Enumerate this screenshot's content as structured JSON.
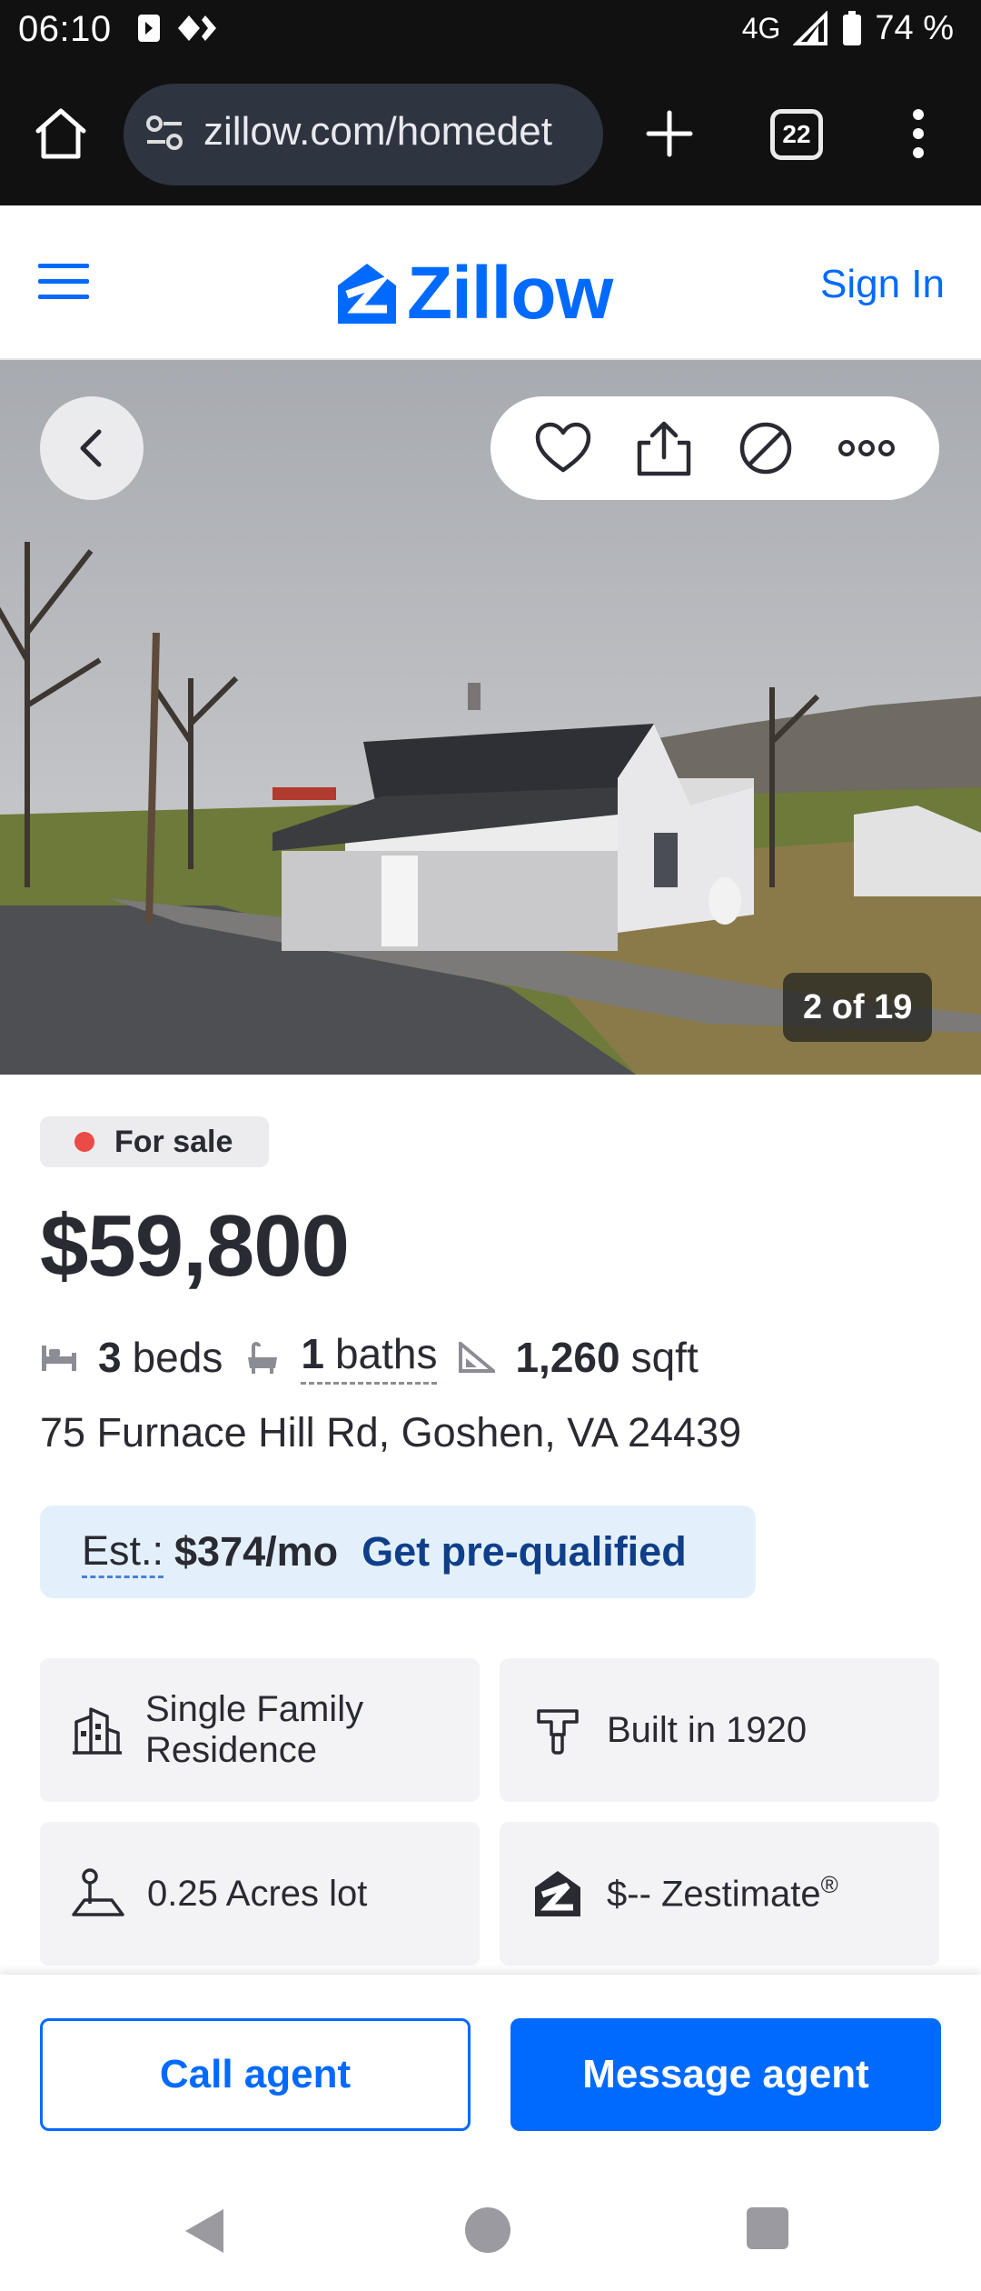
{
  "status_bar": {
    "time": "06:10",
    "network": "4G",
    "battery": "74 %"
  },
  "browser": {
    "url": "zillow.com/homedet",
    "tab_count": "22"
  },
  "header": {
    "logo_text": "Zillow",
    "sign_in_label": "Sign In",
    "brand_color": "#006aff"
  },
  "gallery": {
    "photo_counter": "2 of 19"
  },
  "listing": {
    "status": "For sale",
    "price": "$59,800",
    "beds_count": "3",
    "beds_label": "beds",
    "baths_count": "1",
    "baths_label": "baths",
    "sqft_count": "1,260",
    "sqft_label": "sqft",
    "address": "75 Furnace Hill Rd, Goshen, VA 24439"
  },
  "estimate": {
    "label": "Est.:",
    "value": "$374/mo",
    "link": "Get pre-qualified"
  },
  "facts_tiles": [
    {
      "text": "Single Family Residence",
      "icon": "building-icon"
    },
    {
      "text": "Built in 1920",
      "icon": "hammer-icon"
    },
    {
      "text": "0.25 Acres lot",
      "icon": "lot-icon"
    },
    {
      "text": "$-- Zestimate",
      "icon": "zillow-home-icon",
      "sup": "®"
    }
  ],
  "cta": {
    "call_label": "Call agent",
    "message_label": "Message agent"
  }
}
